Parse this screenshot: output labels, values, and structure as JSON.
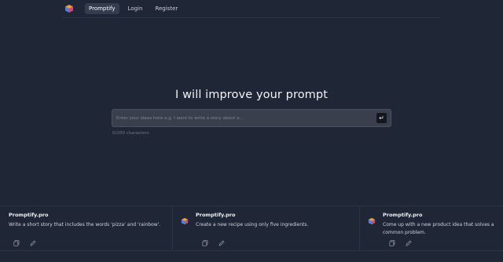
{
  "nav": {
    "items": [
      {
        "label": "Promptify",
        "active": true
      },
      {
        "label": "Login",
        "active": false
      },
      {
        "label": "Register",
        "active": false
      }
    ]
  },
  "hero": {
    "title": "I will improve your prompt",
    "placeholder": "Enter your ideas here e.g. I want to write a story about a...",
    "char_count": "0/200 characters"
  },
  "cards": [
    {
      "title": "Promptify.pro",
      "desc": "Write a short story that includes the words 'pizza' and 'rainbow'."
    },
    {
      "title": "Promptify.pro",
      "desc": "Create a new recipe using only five ingredients."
    },
    {
      "title": "Promptify.pro",
      "desc": "Come up with a new product idea that solves a common problem."
    }
  ],
  "colors": {
    "background": "#1f2635",
    "active_nav": "#343d50",
    "input_bg": "#3a3f4d"
  },
  "icons": [
    "cube-logo-icon",
    "enter-icon",
    "copy-icon",
    "edit-icon"
  ]
}
